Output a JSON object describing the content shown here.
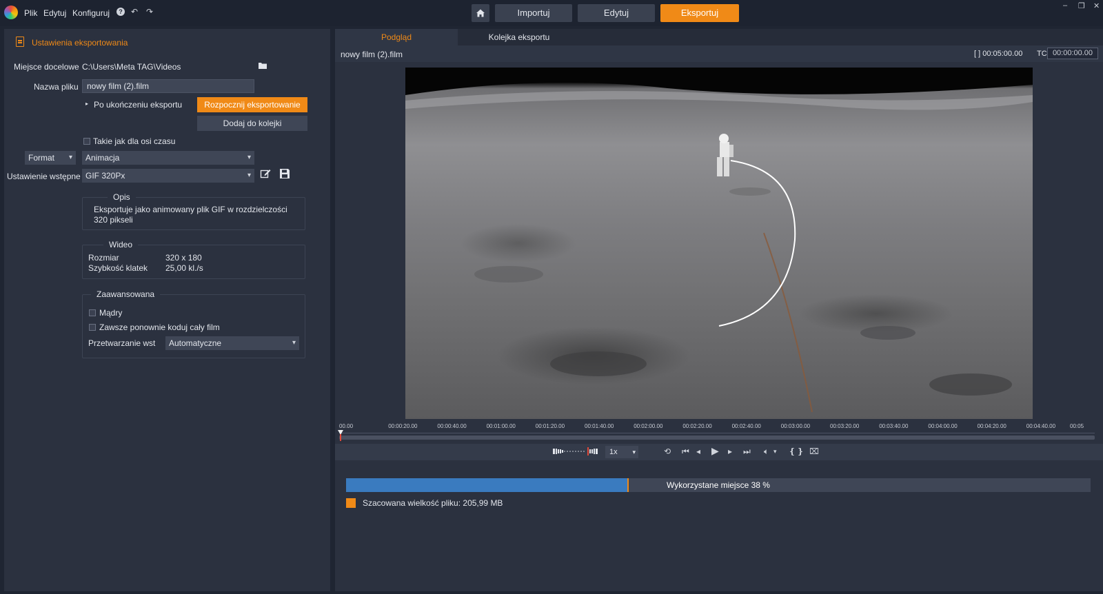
{
  "menu": {
    "file": "Plik",
    "edit": "Edytuj",
    "configure": "Konfiguruj",
    "help": "?"
  },
  "nav": {
    "import": "Importuj",
    "edit": "Edytuj",
    "export": "Eksportuj"
  },
  "window": {
    "minimize": "–",
    "restore": "❐",
    "close": "✕"
  },
  "left": {
    "title": "Ustawienia eksportowania",
    "destination_label": "Miejsce docelowe",
    "destination_value": "C:\\Users\\Meta TAG\\Videos",
    "filename_label": "Nazwa pliku",
    "filename_value": "nowy film (2).film",
    "after_export_label": "Po ukończeniu eksportu",
    "start_export": "Rozpocznij eksportowanie",
    "add_to_queue": "Dodaj do kolejki",
    "same_as_timeline": "Takie jak dla osi czasu",
    "format_label": "Format",
    "format_value": "Animacja",
    "preset_label": "Ustawienie wstępne",
    "preset_value": "GIF 320Px",
    "description_title": "Opis",
    "description_text": "Eksportuje jako animowany plik GIF w rozdzielczości 320 pikseli",
    "video_title": "Wideo",
    "size_label": "Rozmiar",
    "size_value": "320 x 180",
    "fps_label": "Szybkość klatek",
    "fps_value": "25,00 kl./s",
    "advanced_title": "Zaawansowana",
    "smart_label": "Mądry",
    "reencode_label": "Zawsze ponownie koduj cały film",
    "processing_label": "Przetwarzanie wst",
    "processing_value": "Automatyczne"
  },
  "right": {
    "tab_preview": "Podgląd",
    "tab_queue": "Kolejka eksportu",
    "clip_name": "nowy film (2).film",
    "duration": "[ ] 00:05:00.00",
    "tc_label": "TC",
    "tc_value": "00:00:00.00",
    "timeline_ticks": [
      "00.00",
      "00:00:20.00",
      "00:00:40.00",
      "00:01:00.00",
      "00:01:20.00",
      "00:01:40.00",
      "00:02:00.00",
      "00:02:20.00",
      "00:02:40.00",
      "00:03:00.00",
      "00:03:20.00",
      "00:03:40.00",
      "00:04:00.00",
      "00:04:20.00",
      "00:04:40.00",
      "00:05"
    ],
    "speed": "1x",
    "usage_label": "Wykorzystane miejsce 38 %",
    "usage_percent": 38,
    "est_size": "Szacowana wielkość pliku: 205,99 MB"
  }
}
